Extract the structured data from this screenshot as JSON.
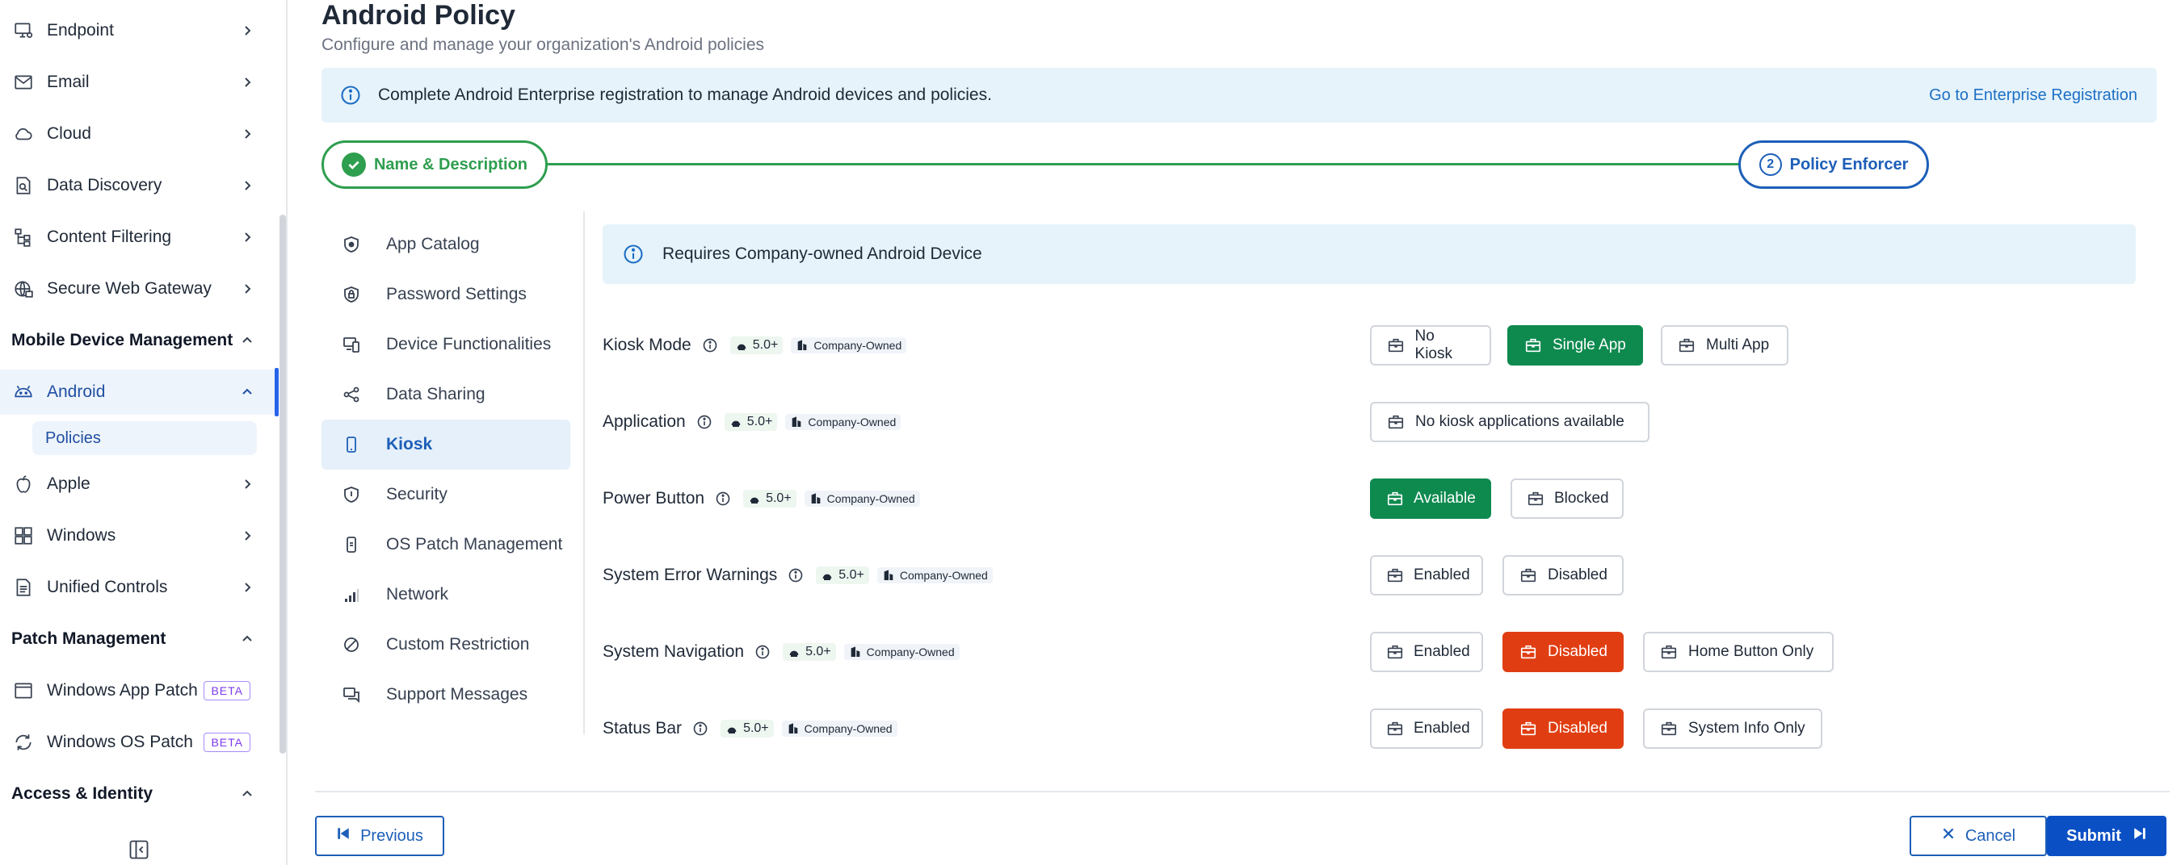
{
  "sidebar": {
    "items": [
      {
        "label": "Endpoint"
      },
      {
        "label": "Email"
      },
      {
        "label": "Cloud"
      },
      {
        "label": "Data Discovery"
      },
      {
        "label": "Content Filtering"
      },
      {
        "label": "Secure Web Gateway"
      }
    ],
    "section_mdm": "Mobile Device Management",
    "android": "Android",
    "policies": "Policies",
    "apple": "Apple",
    "windows": "Windows",
    "unified": "Unified Controls",
    "section_patch": "Patch Management",
    "win_app_patch": "Windows App Patch",
    "win_os_patch": "Windows OS Patch",
    "beta": "BETA",
    "section_access": "Access & Identity"
  },
  "page": {
    "title": "Android Policy",
    "subtitle": "Configure and manage your organization's Android policies"
  },
  "banner": {
    "text": "Complete Android Enterprise registration to manage Android devices and policies.",
    "link": "Go to Enterprise Registration"
  },
  "stepper": {
    "step1": "Name & Description",
    "step2_num": "2",
    "step2": "Policy Enforcer"
  },
  "menu": [
    {
      "label": "App Catalog"
    },
    {
      "label": "Password Settings"
    },
    {
      "label": "Device Functionalities"
    },
    {
      "label": "Data Sharing"
    },
    {
      "label": "Kiosk"
    },
    {
      "label": "Security"
    },
    {
      "label": "OS Patch Management"
    },
    {
      "label": "Network"
    },
    {
      "label": "Custom Restriction"
    },
    {
      "label": "Support Messages"
    }
  ],
  "requirement": "Requires Company-owned Android Device",
  "tags": {
    "version": "5.0+",
    "ownership": "Company-Owned"
  },
  "settings": [
    {
      "label": "Kiosk Mode",
      "options": [
        "No Kiosk",
        "Single App",
        "Multi App"
      ]
    },
    {
      "label": "Application",
      "options": [
        "No kiosk applications available"
      ]
    },
    {
      "label": "Power Button",
      "options": [
        "Available",
        "Blocked"
      ]
    },
    {
      "label": "System Error Warnings",
      "options": [
        "Enabled",
        "Disabled"
      ]
    },
    {
      "label": "System Navigation",
      "options": [
        "Enabled",
        "Disabled",
        "Home Button Only"
      ]
    },
    {
      "label": "Status Bar",
      "options": [
        "Enabled",
        "Disabled",
        "System Info Only"
      ]
    }
  ],
  "footer": {
    "previous": "Previous",
    "cancel": "Cancel",
    "submit": "Submit"
  },
  "colors": {
    "primary": "#1d5fb8",
    "success": "#0e8a4f",
    "danger": "#e03e12",
    "step_green": "#2e9e4f",
    "banner_bg": "#e6f3fb"
  }
}
